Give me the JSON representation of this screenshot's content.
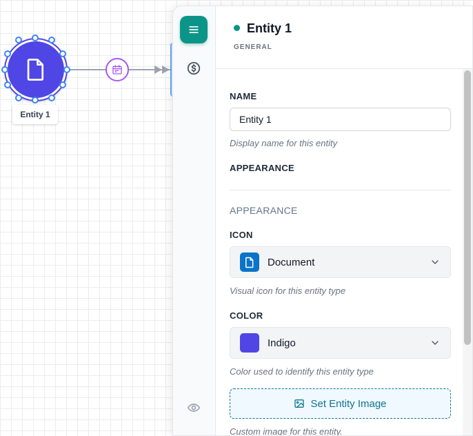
{
  "canvas": {
    "node": {
      "label": "Entity 1",
      "icon": "document-icon",
      "color": "#4f46e5"
    },
    "edge": {
      "badge_icon": "calendar-icon",
      "badge_color": "#a855f7"
    }
  },
  "rail": {
    "items": [
      {
        "icon": "menu-icon",
        "active": true
      },
      {
        "icon": "dollar-icon",
        "active": false
      },
      {
        "icon": "eye-icon",
        "active": false
      }
    ]
  },
  "panel": {
    "title": "Entity 1",
    "subtitle": "GENERAL",
    "status_color": "#0d9488",
    "name": {
      "label": "NAME",
      "value": "Entity 1",
      "help": "Display name for this entity"
    },
    "appearance_label": "APPEARANCE",
    "appearance_group_title": "APPEARANCE",
    "icon": {
      "label": "ICON",
      "selected": "Document",
      "selected_icon": "document-icon",
      "swatch_color": "#0a74c8",
      "help": "Visual icon for this entity type"
    },
    "color": {
      "label": "COLOR",
      "selected": "Indigo",
      "swatch_color": "#4f46e5",
      "help": "Color used to identify this entity type"
    },
    "image": {
      "button_label": "Set Entity Image",
      "button_icon": "image-icon",
      "help": "Custom image for this entity."
    }
  }
}
